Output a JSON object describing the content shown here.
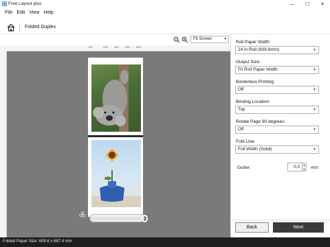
{
  "app": {
    "title": "Free Layout plus",
    "window_controls": {
      "minimize": "—",
      "maximize": "☐",
      "close": "✕"
    }
  },
  "menu": [
    "File",
    "Edit",
    "View",
    "Help"
  ],
  "header": {
    "title": "Folded Duplex",
    "home_icon": "home-icon"
  },
  "preview": {
    "zoom_value": "Fit Screen",
    "ruler_numbers": [
      "100",
      "200",
      "300",
      "400",
      "500"
    ]
  },
  "settings": {
    "roll_paper_width": {
      "label": "Roll Paper Width:",
      "value": "24 in Roll (609.6mm)"
    },
    "output_size": {
      "label": "Output Size:",
      "value": "Fit Roll Paper Width"
    },
    "borderless": {
      "label": "Borderless Printing:",
      "value": "Off"
    },
    "binding": {
      "label": "Binding Location:",
      "value": "Top"
    },
    "rotate": {
      "label": "Rotate Page 90 degrees:",
      "value": "Off"
    },
    "fold_line": {
      "label": "Fold Line:",
      "value": "Full Width (Solid)"
    },
    "gutter": {
      "label": "Gutter:",
      "value": "0.0",
      "unit": "mm"
    }
  },
  "buttons": {
    "back": "Back",
    "next": "Next"
  },
  "status": {
    "text": "Folded Paper Size: 609.6 x 667.4 mm"
  },
  "colors": {
    "canvas": "#7a7a7a",
    "next_button": "#3b3b3b",
    "statusbar": "#1e1e1e"
  }
}
